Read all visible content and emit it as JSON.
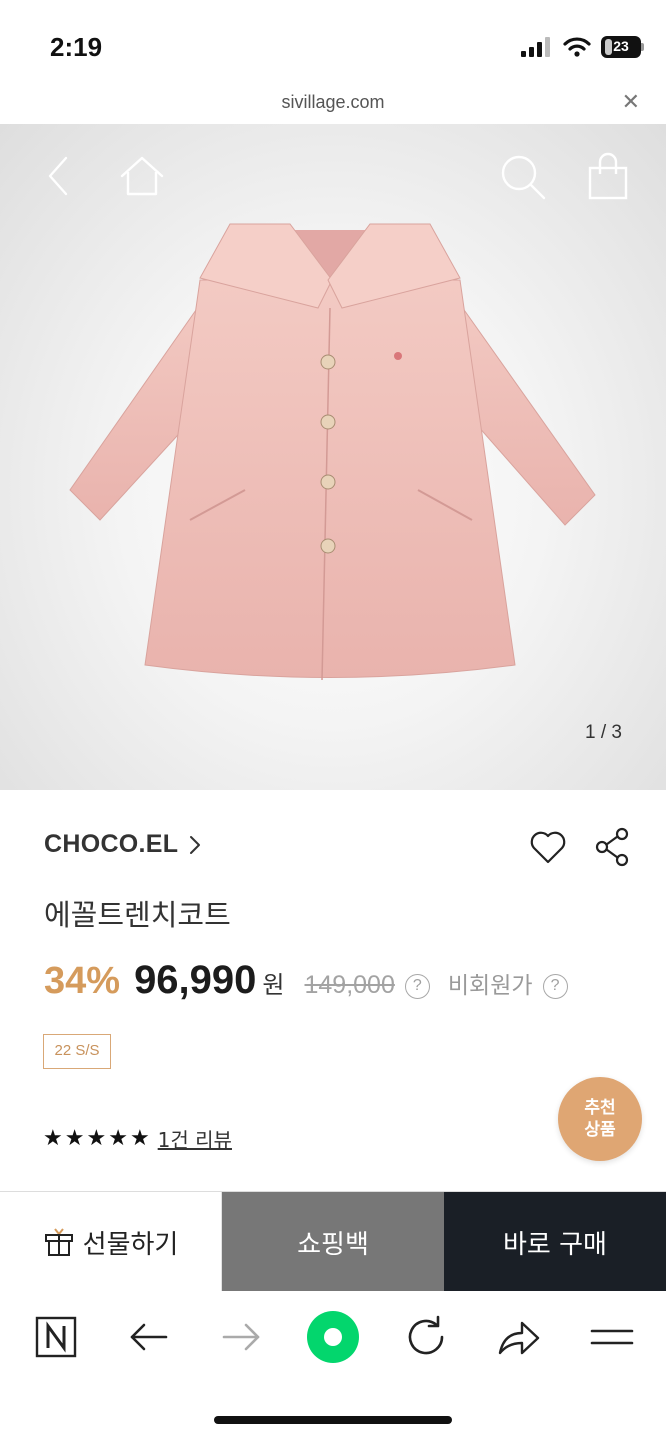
{
  "status_bar": {
    "time": "2:19",
    "battery_level": "23"
  },
  "browser_url": {
    "domain": "sivillage.com",
    "close_icon": "close-icon"
  },
  "product_image": {
    "counter": "1 / 3",
    "garment_color": "#f0c4be"
  },
  "product": {
    "brand": "CHOCO.EL",
    "name": "에꼴트렌치코트",
    "discount": "34%",
    "price": "96,990",
    "currency": "원",
    "original_price": "149,000",
    "member_price_label": "비회원가",
    "help_glyph": "?",
    "season": "22 S/S",
    "rating": 5,
    "review_link": "1건 리뷰"
  },
  "recommend_badge": {
    "line1": "추천",
    "line2": "상품"
  },
  "actions": {
    "gift": "선물하기",
    "bag": "쇼핑백",
    "buy": "바로 구매"
  },
  "colors": {
    "accent": "#d59b5c",
    "buy_bg": "#1a1f26",
    "bag_bg": "#777777",
    "naver_green": "#03d66d"
  },
  "icons": [
    "back-icon",
    "home-icon",
    "search-icon",
    "shopping-bag-icon",
    "heart-icon",
    "share-icon",
    "gift-icon",
    "naver-icon",
    "refresh-icon",
    "menu-icon"
  ]
}
